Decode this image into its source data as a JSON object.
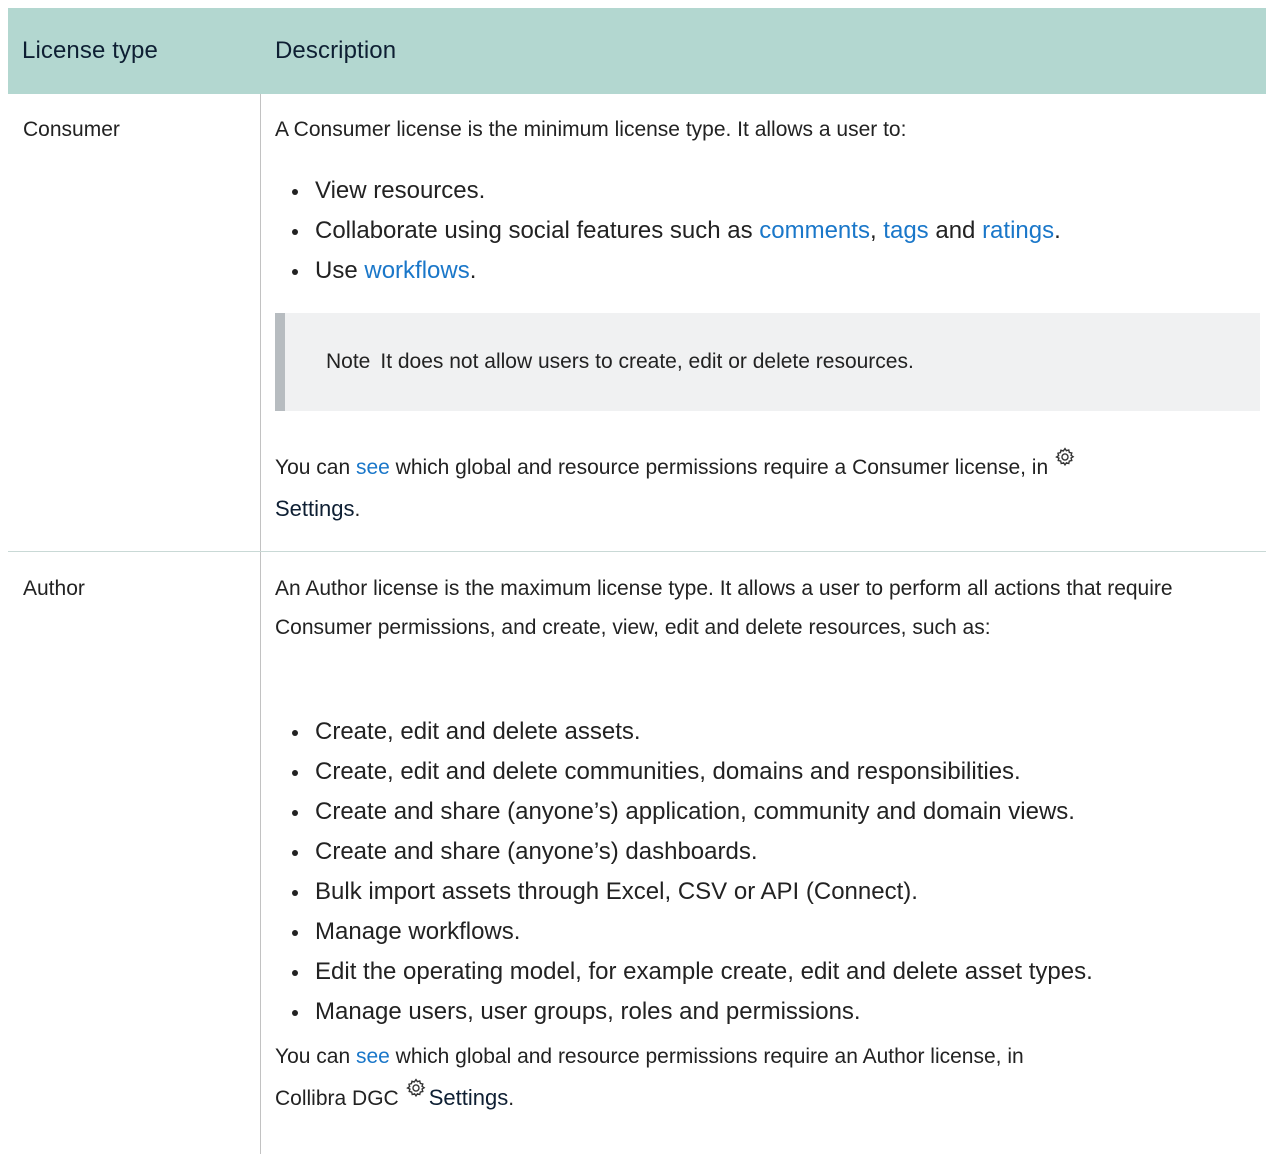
{
  "table": {
    "headers": {
      "license_type": "License type",
      "description": "Description"
    },
    "rows": [
      {
        "type": "Consumer",
        "intro": "A Consumer license is the minimum license type. It allows a user to:",
        "bullets": {
          "b1": "View resources.",
          "b2_pre": "Collaborate using social features such as ",
          "b2_link1": "comments",
          "b2_sep1": ", ",
          "b2_link2": "tags",
          "b2_sep2": " and ",
          "b2_link3": "ratings",
          "b2_end": ".",
          "b3_pre": "Use ",
          "b3_link": "workflows",
          "b3_end": "."
        },
        "note": {
          "label": "Note",
          "text": "It does not allow users to create, edit or delete resources."
        },
        "footer": {
          "pre": "You can ",
          "link": "see",
          "mid": " which global and resource permissions require a Consumer license, in",
          "icon": "gear-icon",
          "strong": "Settings",
          "end": "."
        }
      },
      {
        "type": "Author",
        "intro": "An Author license is the maximum license type. It allows a user to perform all actions that require Consumer permissions, and create, view, edit and delete resources, such as:",
        "bullets": [
          "Create, edit and delete assets.",
          "Create, edit and delete communities, domains and responsibilities.",
          "Create and share (anyone’s) application, community and domain views.",
          "Create and share (anyone’s) dashboards.",
          "Bulk import assets through Excel, CSV or API (Connect).",
          "Manage workflows.",
          "Edit the operating model, for example create, edit and delete asset types.",
          "Manage users, user groups, roles and permissions."
        ],
        "footer": {
          "pre": "You can ",
          "link": "see",
          "mid": " which global and resource permissions require an Author license, in",
          "mid2": "Collibra DGC",
          "icon": "gear-icon",
          "strong": "Settings",
          "end": "."
        }
      }
    ]
  },
  "colors": {
    "header_bg": "#b3d7d0",
    "link": "#1a77c9",
    "note_bg": "#f0f1f2",
    "note_border": "#b7bcc0"
  }
}
